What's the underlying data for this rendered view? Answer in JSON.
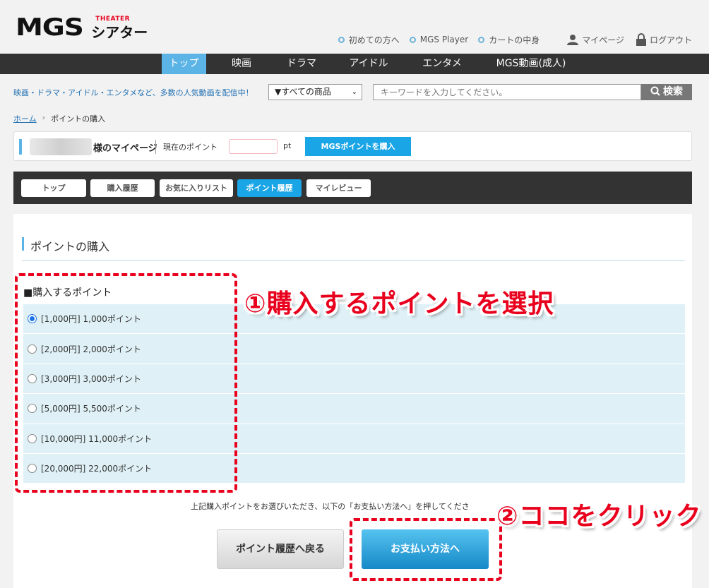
{
  "header": {
    "logo_text": "MGS",
    "logo_sub": "THEATER",
    "logo_jp": "シアター",
    "links": [
      "初めての方へ",
      "MGS Player",
      "カートの中身"
    ],
    "mypage": "マイページ",
    "logout": "ログアウト"
  },
  "gnav": [
    "トップ",
    "映画",
    "ドラマ",
    "アイドル",
    "エンタメ",
    "MGS動画(成人)"
  ],
  "search": {
    "catch": "映画・ドラマ・アイドル・エンタメなど、多数の人気動画を配信中！",
    "select": "▼すべての商品",
    "placeholder": "キーワードを入力してください。",
    "button": "検索"
  },
  "breadcrumb": {
    "home": "ホーム",
    "current": "ポイントの購入"
  },
  "mypage_bar": {
    "title": "様のマイページ",
    "current_label": "現在のポイント",
    "unit": "pt",
    "buy_button": "MGSポイントを購入"
  },
  "subnav": [
    "トップ",
    "購入履歴",
    "お気に入りリスト",
    "ポイント履歴",
    "マイレビュー"
  ],
  "main": {
    "title": "ポイントの購入",
    "points_label": "■購入するポイント",
    "options": [
      "[1,000円] 1,000ポイント",
      "[2,000円] 2,000ポイント",
      "[3,000円] 3,000ポイント",
      "[5,000円] 5,500ポイント",
      "[10,000円] 11,000ポイント",
      "[20,000円] 22,000ポイント"
    ],
    "selected_index": 0,
    "note": "上記購入ポイントをお選びいただき、以下の「お支払い方法へ」を押してくださ",
    "back_button": "ポイント履歴へ戻る",
    "pay_button": "お支払い方法へ"
  },
  "annotations": {
    "step1": "①購入するポイントを選択",
    "step2": "②ココをクリック",
    "color": "#e8001c"
  }
}
